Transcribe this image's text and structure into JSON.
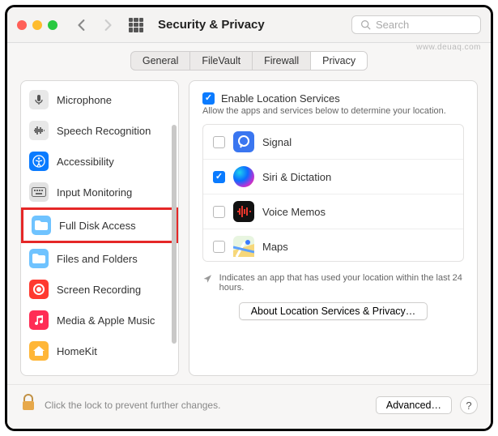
{
  "window": {
    "title": "Security & Privacy",
    "search_placeholder": "Search"
  },
  "tabs": {
    "general": "General",
    "filevault": "FileVault",
    "firewall": "Firewall",
    "privacy": "Privacy",
    "active": "privacy"
  },
  "sidebar": {
    "items": [
      {
        "id": "microphone",
        "label": "Microphone",
        "icon": "microphone-icon",
        "bg": "#e8e8e8",
        "fg": "#555"
      },
      {
        "id": "speech",
        "label": "Speech Recognition",
        "icon": "waveform-icon",
        "bg": "#e8e8e8",
        "fg": "#444"
      },
      {
        "id": "accessibility",
        "label": "Accessibility",
        "icon": "accessibility-icon",
        "bg": "#0a7bff",
        "fg": "#fff"
      },
      {
        "id": "input",
        "label": "Input Monitoring",
        "icon": "keyboard-icon",
        "bg": "#e2e2e2",
        "fg": "#666"
      },
      {
        "id": "fulldisk",
        "label": "Full Disk Access",
        "icon": "folder-icon",
        "bg": "#6fc3ff",
        "fg": "#fff",
        "highlighted": true
      },
      {
        "id": "files",
        "label": "Files and Folders",
        "icon": "folder-icon",
        "bg": "#6fc3ff",
        "fg": "#fff"
      },
      {
        "id": "screenrec",
        "label": "Screen Recording",
        "icon": "record-icon",
        "bg": "#ff3a30",
        "fg": "#fff"
      },
      {
        "id": "media",
        "label": "Media & Apple Music",
        "icon": "music-icon",
        "bg": "#ff2d55",
        "fg": "#fff"
      },
      {
        "id": "homekit",
        "label": "HomeKit",
        "icon": "home-icon",
        "bg": "#ffb637",
        "fg": "#fff"
      }
    ]
  },
  "main": {
    "enable_label": "Enable Location Services",
    "enable_checked": true,
    "help": "Allow the apps and services below to determine your location.",
    "apps": [
      {
        "id": "signal",
        "label": "Signal",
        "checked": false,
        "bg": "#3a76f0",
        "shape": "bubble"
      },
      {
        "id": "siri",
        "label": "Siri & Dictation",
        "checked": true,
        "bg": "linear-gradient(135deg,#1fd1ec,#b933d6,#ff3b6b)",
        "shape": "orb"
      },
      {
        "id": "voicememos",
        "label": "Voice Memos",
        "checked": false,
        "bg": "#111",
        "shape": "wave-red"
      },
      {
        "id": "maps",
        "label": "Maps",
        "checked": false,
        "bg": "#fff",
        "shape": "map"
      }
    ],
    "indicator_text": "Indicates an app that has used your location within the last 24 hours.",
    "about_btn": "About Location Services & Privacy…"
  },
  "footer": {
    "lock_text": "Click the lock to prevent further changes.",
    "advanced": "Advanced…",
    "help": "?"
  },
  "watermark": "www.deuaq.com"
}
